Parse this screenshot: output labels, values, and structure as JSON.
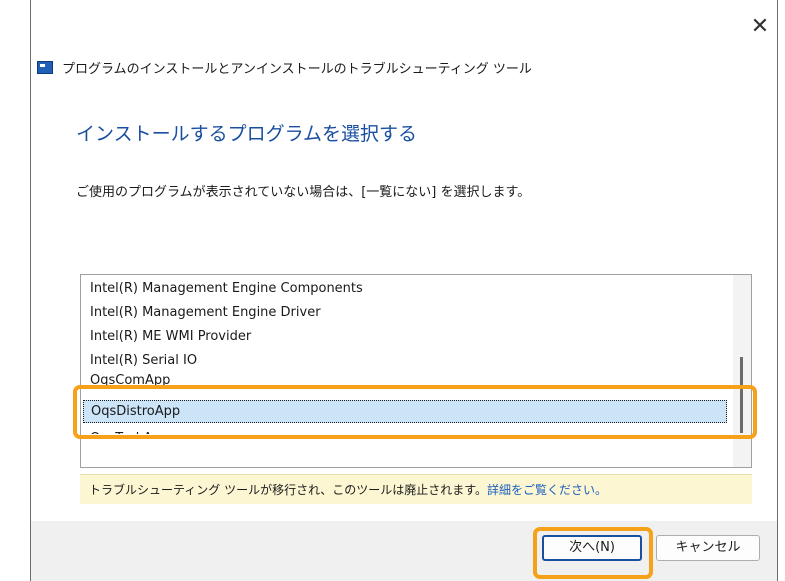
{
  "window": {
    "close_glyph": "✕",
    "title": "プログラムのインストールとアンインストールのトラブルシューティング ツール"
  },
  "content": {
    "heading": "インストールするプログラムを選択する",
    "instruction": "ご使用のプログラムが表示されていない場合は、[一覧にない] を選択します。"
  },
  "program_list": {
    "items": [
      {
        "label": "Intel(R) Management Engine Components",
        "selected": false
      },
      {
        "label": "Intel(R) Management Engine Driver",
        "selected": false
      },
      {
        "label": "Intel(R) ME WMI Provider",
        "selected": false
      },
      {
        "label": "Intel(R) Serial IO",
        "selected": false
      },
      {
        "label": "OqsComApp",
        "selected": false
      },
      {
        "label": "OqsDistroApp",
        "selected": true
      },
      {
        "label": "OqsTaskApp",
        "selected": false
      }
    ],
    "scroll_position": 0.8
  },
  "info_bar": {
    "text": "トラブルシューティング ツールが移行され、このツールは廃止されます。",
    "link": "詳細をご覧ください。"
  },
  "buttons": {
    "next": "次へ(N)",
    "cancel": "キャンセル"
  },
  "colors": {
    "heading": "#1a4fa0",
    "selection": "#cce4f7",
    "info_background": "#fcf6d2",
    "highlight": "#f5a21a",
    "link": "#1a5fbf"
  }
}
